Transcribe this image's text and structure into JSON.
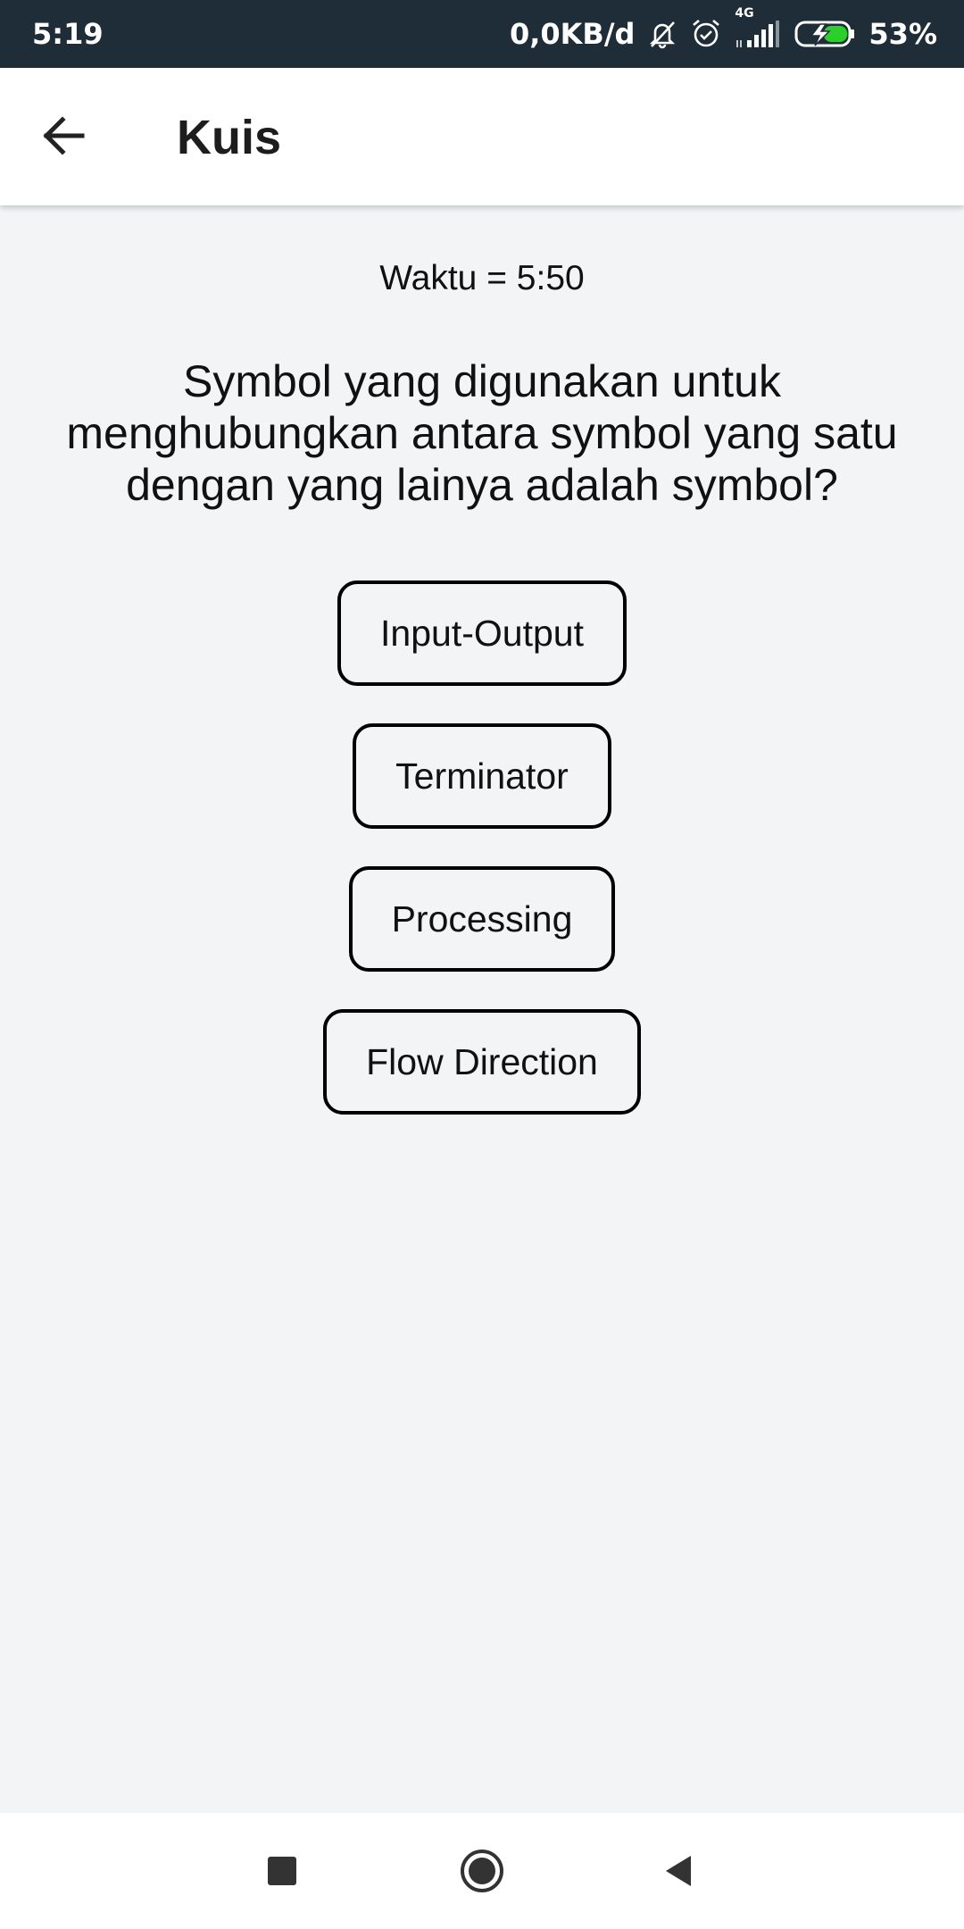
{
  "status_bar": {
    "time": "5:19",
    "network_speed": "0,0KB/d",
    "network_type": "4G",
    "battery": "53%",
    "icons": [
      "mute-icon",
      "alarm-icon",
      "signal-icon",
      "battery-charging-icon"
    ]
  },
  "app_bar": {
    "title": "Kuis",
    "back_icon": "arrow-back-icon"
  },
  "quiz": {
    "timer": "Waktu = 5:50",
    "question": "Symbol yang digunakan untuk menghubungkan antara symbol yang satu dengan yang lainya adalah symbol?",
    "options": [
      "Input-Output",
      "Terminator",
      "Processing",
      "Flow Direction"
    ]
  },
  "nav_bar": {
    "icons": [
      "recents-square-icon",
      "home-circle-icon",
      "back-triangle-icon"
    ]
  },
  "colors": {
    "status_bar_bg": "#1f2d38",
    "background": "#f3f4f6",
    "app_bar_bg": "#ffffff",
    "battery_accent": "#2bd12b"
  }
}
